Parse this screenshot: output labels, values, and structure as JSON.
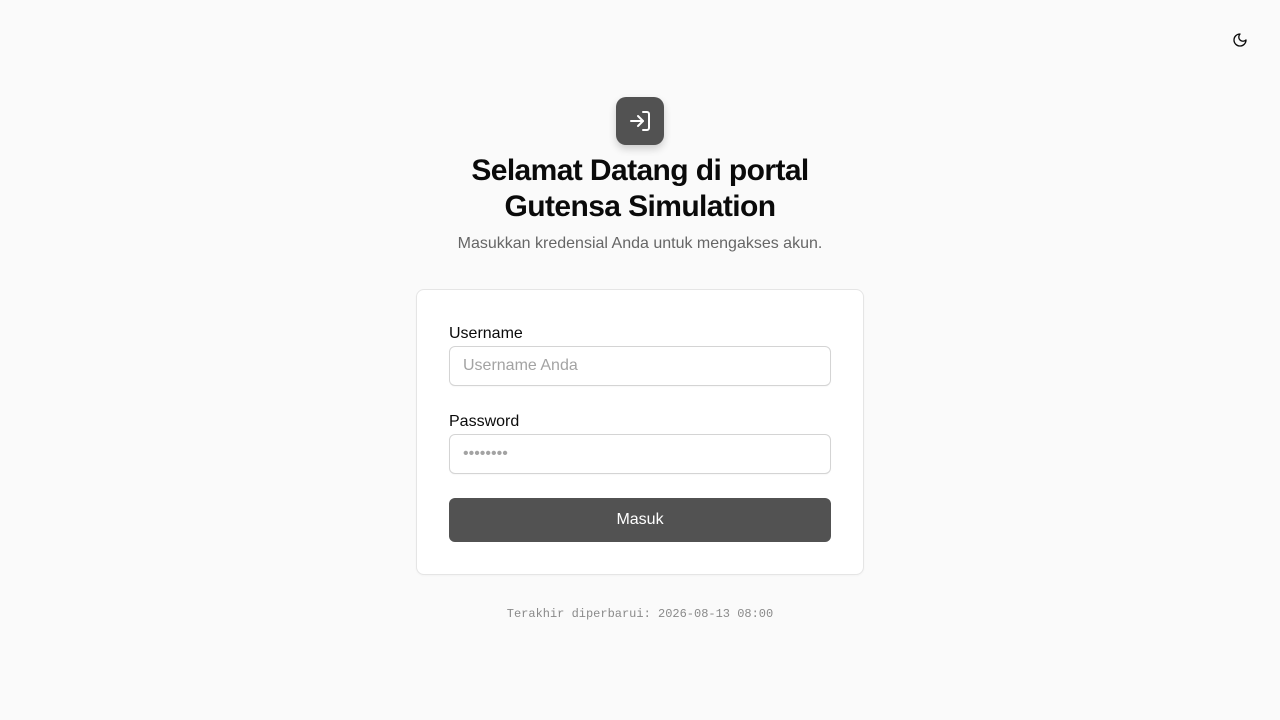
{
  "header": {
    "theme_toggle_icon": "moon-icon"
  },
  "hero": {
    "logo_icon": "log-in-icon",
    "title_line1": "Selamat Datang di portal",
    "title_line2": "Gutensa Simulation",
    "subtitle": "Masukkan kredensial Anda untuk mengakses akun."
  },
  "form": {
    "username": {
      "label": "Username",
      "value": "",
      "placeholder": "Username Anda"
    },
    "password": {
      "label": "Password",
      "value": "",
      "placeholder": "••••••••"
    },
    "submit_label": "Masuk"
  },
  "footer": {
    "last_updated": "Terakhir diperbarui: 2026-08-13 08:00"
  },
  "colors": {
    "background": "#fafafa",
    "primary": "#525252",
    "card_border": "#e5e5e5",
    "muted_text": "#666666"
  }
}
